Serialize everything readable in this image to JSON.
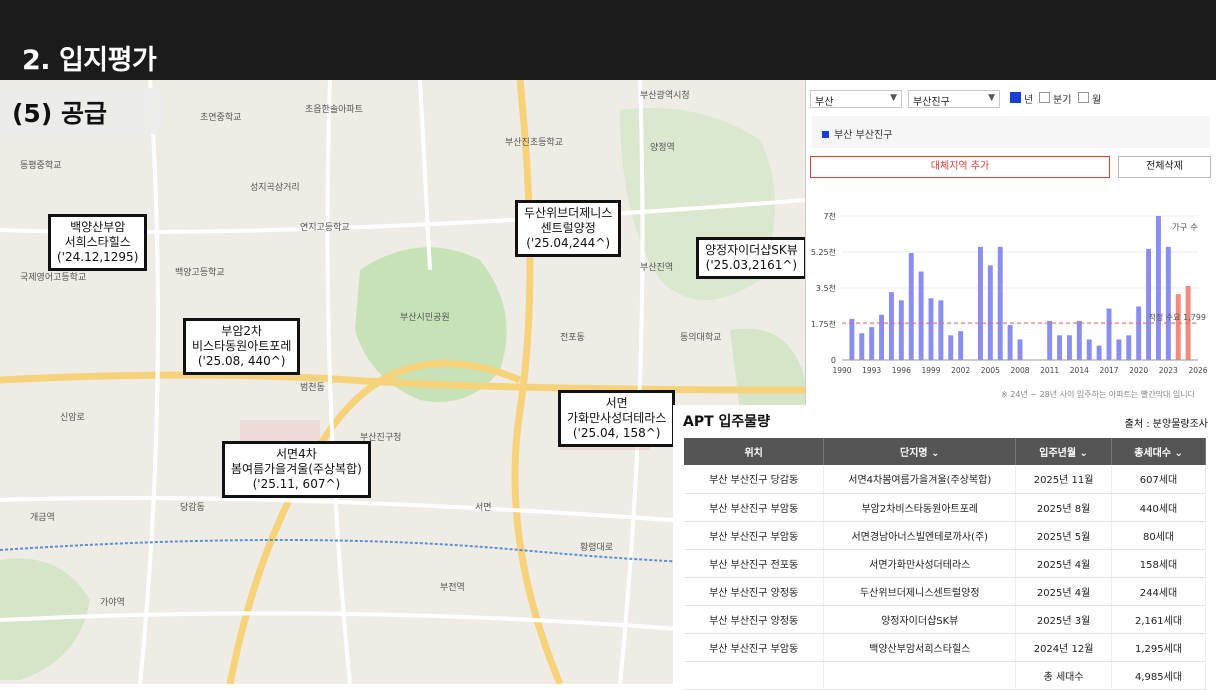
{
  "slide": {
    "title": "2. 입지평가",
    "subtitle": "(5) 공급"
  },
  "map": {
    "callouts": [
      {
        "lines": [
          "백양산부암",
          "서희스타힐스",
          "('24.12,1295)"
        ]
      },
      {
        "lines": [
          "두산위브더제니스",
          "센트럴양정",
          "('25.04,244^)"
        ]
      },
      {
        "lines": [
          "양정자이더샵SK뷰",
          "('25.03,2161^)"
        ]
      },
      {
        "lines": [
          "부암2차",
          "비스타동원아트포레",
          "('25.08, 440^)"
        ]
      },
      {
        "lines": [
          "서면",
          "가화만사성더테라스",
          "('25.04, 158^)"
        ]
      },
      {
        "lines": [
          "서면4차",
          "봄여름가을겨울(주상복합)",
          "('25.11, 607^)"
        ]
      }
    ],
    "labels": [
      "부산광역시청",
      "초연중학교",
      "초읍한솔아파트",
      "부산진초등학교",
      "연지고등학교",
      "백양고등학교",
      "부산시민공원",
      "동평중학교",
      "국제영어고등학교",
      "부산진역",
      "당감동",
      "서면",
      "부산진구청",
      "신암로",
      "동의대학교",
      "부전역",
      "성지곡삼거리",
      "황령대로",
      "양정역",
      "전포동",
      "범천동",
      "개금역",
      "가야역"
    ]
  },
  "panel": {
    "region": "부산",
    "district": "부산진구",
    "period_options": [
      "년",
      "분기",
      "월"
    ],
    "period_selected": "년",
    "legend": "부산 부산진구",
    "add_button": "대체지역 추가",
    "delete_button": "전체삭제",
    "note": "※ 24년 ~ 28년 사이 입주하는 아파트는 빨간막대 입니다"
  },
  "chart_data": {
    "type": "bar",
    "x": [
      1990,
      1991,
      1992,
      1993,
      1994,
      1995,
      1996,
      1997,
      1998,
      1999,
      2000,
      2001,
      2002,
      2003,
      2004,
      2005,
      2006,
      2007,
      2008,
      2009,
      2010,
      2011,
      2012,
      2013,
      2014,
      2015,
      2016,
      2017,
      2018,
      2019,
      2020,
      2021,
      2022,
      2023,
      2024,
      2025
    ],
    "values": [
      0,
      2000,
      1300,
      1600,
      2200,
      3300,
      2900,
      5200,
      4300,
      3000,
      2900,
      1200,
      1400,
      0,
      5500,
      4600,
      5500,
      1700,
      1000,
      0,
      0,
      1900,
      1200,
      1200,
      1900,
      1000,
      700,
      2500,
      1000,
      1200,
      2600,
      5400,
      7000,
      5500,
      3200,
      3600
    ],
    "highlight_from": 2024,
    "bar_color": "#8a8ef0",
    "highlight_color": "#f08a7a",
    "xticks": [
      1990,
      1993,
      1996,
      1999,
      2002,
      2005,
      2008,
      2011,
      2014,
      2017,
      2020,
      2023,
      2026
    ],
    "yticks": [
      "0",
      "1.75천",
      "3.5천",
      "5.25천",
      "7천"
    ],
    "ylim": [
      0,
      7000
    ],
    "ylabel": "가구 수",
    "reference_line": {
      "value": 1799,
      "label": "적정 수요 1,799"
    }
  },
  "table": {
    "title": "APT 입주물량",
    "source": "출처 : 분양물량조사",
    "headers": [
      "위치",
      "단지명 ⌄",
      "입주년월 ⌄",
      "총세대수 ⌄"
    ],
    "rows": [
      [
        "부산 부산진구 당감동",
        "서면4차봄여름가을겨울(주상복합)",
        "2025년 11월",
        "607세대"
      ],
      [
        "부산 부산진구 부암동",
        "부암2차비스타동원아트포레",
        "2025년 8월",
        "440세대"
      ],
      [
        "부산 부산진구 부암동",
        "서면경남아너스빌엔테로까사(주)",
        "2025년 5월",
        "80세대"
      ],
      [
        "부산 부산진구 전포동",
        "서면가화만사성더테라스",
        "2025년 4월",
        "158세대"
      ],
      [
        "부산 부산진구 양정동",
        "두산위브더제니스센트럴양정",
        "2025년 4월",
        "244세대"
      ],
      [
        "부산 부산진구 양정동",
        "양정자이더샵SK뷰",
        "2025년 3월",
        "2,161세대"
      ],
      [
        "부산 부산진구 부암동",
        "백양산부암서희스타힐스",
        "2024년 12월",
        "1,295세대"
      ],
      [
        "",
        "",
        "총 세대수",
        "4,985세대"
      ]
    ]
  }
}
